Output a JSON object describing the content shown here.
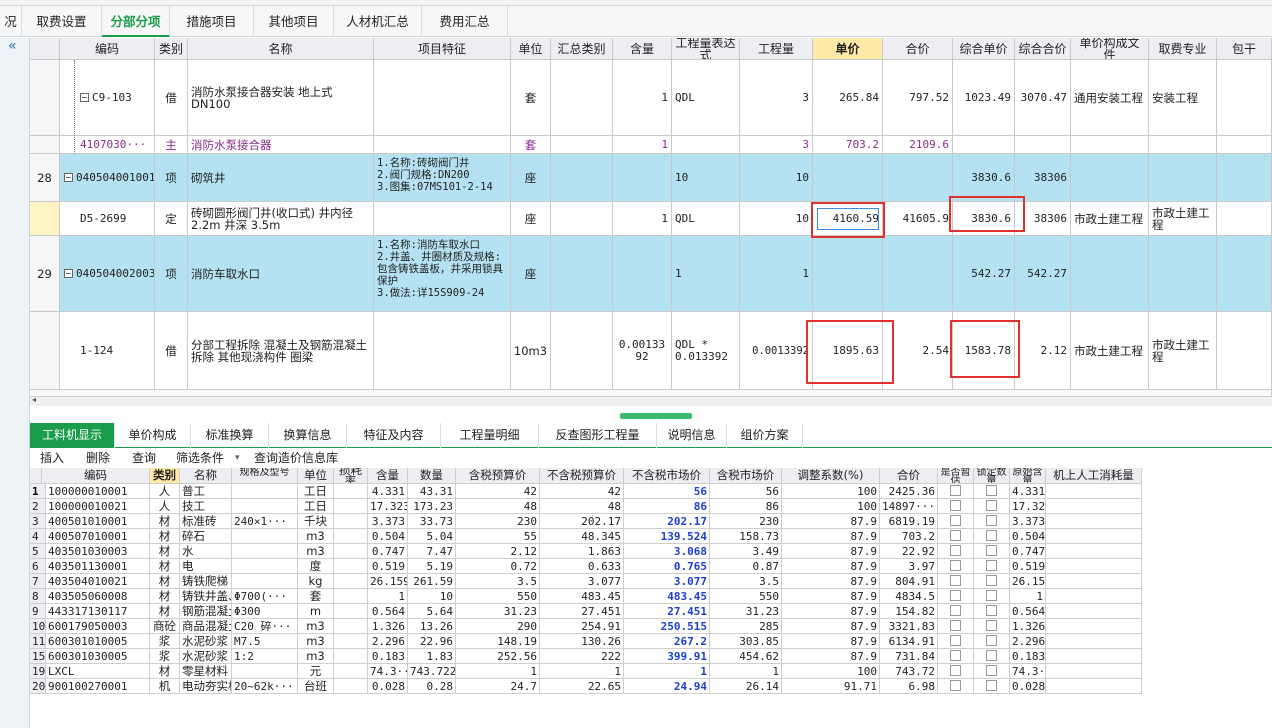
{
  "top_tabs": [
    "况",
    "取费设置",
    "分部分项",
    "措施项目",
    "其他项目",
    "人材机汇总",
    "费用汇总"
  ],
  "collapse_icon": "«",
  "grid": {
    "headers": [
      "编码",
      "类别",
      "名称",
      "项目特征",
      "单位",
      "汇总类别",
      "含量",
      "工程量表达式",
      "工程量",
      "单价",
      "合价",
      "综合单价",
      "综合合价",
      "单价构成文件",
      "取费专业",
      "包干"
    ],
    "rows": [
      {
        "no": "",
        "code": "C9-103",
        "type": "借",
        "name": "消防水泵接合器安装 地上式DN100",
        "feature": "",
        "unit": "套",
        "sum_cat": "",
        "content": "1",
        "expr": "QDL",
        "qty": "3",
        "price": "265.84",
        "total": "797.52",
        "comp_price": "1023.49",
        "comp_total": "3070.47",
        "file": "通用安装工程",
        "major": "安装工程"
      },
      {
        "no": "",
        "code": "4107030···",
        "type": "主",
        "name": "消防水泵接合器",
        "feature": "",
        "unit": "套",
        "sum_cat": "",
        "content": "1",
        "expr": "",
        "qty": "3",
        "price": "703.2",
        "total": "2109.6",
        "comp_price": "",
        "comp_total": "",
        "file": "",
        "major": ""
      },
      {
        "no": "28",
        "code": "040504001001",
        "type": "项",
        "name": "砌筑井",
        "feature": "1.名称:砖砌阀门井\n2.阀门规格:DN200\n3.图集:07MS101-2-14",
        "unit": "座",
        "sum_cat": "",
        "content": "",
        "expr": "10",
        "qty": "10",
        "price": "",
        "total": "",
        "comp_price": "3830.6",
        "comp_total": "38306",
        "file": "",
        "major": ""
      },
      {
        "no": "",
        "code": "D5-2699",
        "type": "定",
        "name": "砖砌圆形阀门井(收口式) 井内径2.2m 井深 3.5m",
        "feature": "",
        "unit": "座",
        "sum_cat": "",
        "content": "1",
        "expr": "QDL",
        "qty": "10",
        "price": "4160.59",
        "total": "41605.9",
        "comp_price": "3830.6",
        "comp_total": "38306",
        "file": "市政土建工程",
        "major": "市政土建工程"
      },
      {
        "no": "29",
        "code": "040504002003",
        "type": "项",
        "name": "消防车取水口",
        "feature": "1.名称:消防车取水口\n2.井盖、井圈材质及规格:包含铸铁盖板，井采用锁具保护\n3.做法:详15S909-24",
        "unit": "座",
        "sum_cat": "",
        "content": "",
        "expr": "1",
        "qty": "1",
        "price": "",
        "total": "",
        "comp_price": "542.27",
        "comp_total": "542.27",
        "file": "",
        "major": ""
      },
      {
        "no": "",
        "code": "1-124",
        "type": "借",
        "name": "分部工程拆除 混凝土及钢筋混凝土拆除 其他现浇构件 圈梁",
        "feature": "",
        "unit": "10m3",
        "sum_cat": "",
        "content": "0.0013392",
        "expr": "QDL * 0.013392",
        "qty": "0.0013392",
        "price": "1895.63",
        "total": "2.54",
        "comp_price": "1583.78",
        "comp_total": "2.12",
        "file": "市政土建工程",
        "major": "市政土建工程"
      }
    ]
  },
  "bottom_tabs": [
    "工料机显示",
    "单价构成",
    "标准换算",
    "换算信息",
    "特征及内容",
    "工程量明细",
    "反查图形工程量",
    "说明信息",
    "组价方案"
  ],
  "toolbar": [
    "插入",
    "删除",
    "查询",
    "筛选条件",
    "▾",
    "查询造价信息库"
  ],
  "lower": {
    "headers": [
      "编码",
      "类别",
      "名称",
      "规格及型号",
      "单位",
      "损耗率",
      "含量",
      "数量",
      "含税预算价",
      "不含税预算价",
      "不含税市场价",
      "含税市场价",
      "调整系数(%)",
      "合价",
      "是否暂估",
      "锁定数量",
      "原始含量",
      "机上人工消耗量"
    ],
    "rows": [
      {
        "no": "1",
        "code": "100000010001",
        "type": "人",
        "name": "普工",
        "spec": "",
        "unit": "工日",
        "loss": "",
        "content": "4.331",
        "qty": "43.31",
        "tax_budget": "42",
        "notax_budget": "42",
        "notax_market": "56",
        "tax_market": "56",
        "factor": "100",
        "total": "2425.36",
        "orig": "4.331"
      },
      {
        "no": "2",
        "code": "100000010021",
        "type": "人",
        "name": "技工",
        "spec": "",
        "unit": "工日",
        "loss": "",
        "content": "17.323",
        "qty": "173.23",
        "tax_budget": "48",
        "notax_budget": "48",
        "notax_market": "86",
        "tax_market": "86",
        "factor": "100",
        "total": "14897···",
        "orig": "17.323"
      },
      {
        "no": "3",
        "code": "400501010001",
        "type": "材",
        "name": "标准砖",
        "spec": "240×1···",
        "unit": "千块",
        "loss": "",
        "content": "3.373",
        "qty": "33.73",
        "tax_budget": "230",
        "notax_budget": "202.17",
        "notax_market": "202.17",
        "tax_market": "230",
        "factor": "87.9",
        "total": "6819.19",
        "orig": "3.373"
      },
      {
        "no": "4",
        "code": "400507010001",
        "type": "材",
        "name": "碎石",
        "spec": "",
        "unit": "m3",
        "loss": "",
        "content": "0.504",
        "qty": "5.04",
        "tax_budget": "55",
        "notax_budget": "48.345",
        "notax_market": "139.524",
        "tax_market": "158.73",
        "factor": "87.9",
        "total": "703.2",
        "orig": "0.504"
      },
      {
        "no": "5",
        "code": "403501030003",
        "type": "材",
        "name": "水",
        "spec": "",
        "unit": "m3",
        "loss": "",
        "content": "0.747",
        "qty": "7.47",
        "tax_budget": "2.12",
        "notax_budget": "1.863",
        "notax_market": "3.068",
        "tax_market": "3.49",
        "factor": "87.9",
        "total": "22.92",
        "orig": "0.747"
      },
      {
        "no": "6",
        "code": "403501130001",
        "type": "材",
        "name": "电",
        "spec": "",
        "unit": "度",
        "loss": "",
        "content": "0.519",
        "qty": "5.19",
        "tax_budget": "0.72",
        "notax_budget": "0.633",
        "notax_market": "0.765",
        "tax_market": "0.87",
        "factor": "87.9",
        "total": "3.97",
        "orig": "0.519"
      },
      {
        "no": "7",
        "code": "403504010021",
        "type": "材",
        "name": "铸铁爬梯",
        "spec": "",
        "unit": "kg",
        "loss": "",
        "content": "26.159",
        "qty": "261.59",
        "tax_budget": "3.5",
        "notax_budget": "3.077",
        "notax_market": "3.077",
        "tax_market": "3.5",
        "factor": "87.9",
        "total": "804.91",
        "orig": "26.159"
      },
      {
        "no": "8",
        "code": "403505060008",
        "type": "材",
        "name": "铸铁井盖、井座",
        "spec": "Φ700(···",
        "unit": "套",
        "loss": "",
        "content": "1",
        "qty": "10",
        "tax_budget": "550",
        "notax_budget": "483.45",
        "notax_market": "483.45",
        "tax_market": "550",
        "factor": "87.9",
        "total": "4834.5",
        "orig": "1"
      },
      {
        "no": "9",
        "code": "443317130117",
        "type": "材",
        "name": "钢筋混凝土管",
        "spec": "Φ300",
        "unit": "m",
        "loss": "",
        "content": "0.564",
        "qty": "5.64",
        "tax_budget": "31.23",
        "notax_budget": "27.451",
        "notax_market": "27.451",
        "tax_market": "31.23",
        "factor": "87.9",
        "total": "154.82",
        "orig": "0.564"
      },
      {
        "no": "10",
        "code": "600179050003",
        "type": "商砼",
        "name": "商品混凝土",
        "spec": "C20 碎···",
        "unit": "m3",
        "loss": "",
        "content": "1.326",
        "qty": "13.26",
        "tax_budget": "290",
        "notax_budget": "254.91",
        "notax_market": "250.515",
        "tax_market": "285",
        "factor": "87.9",
        "total": "3321.83",
        "orig": "1.326"
      },
      {
        "no": "11",
        "code": "600301010005",
        "type": "浆",
        "name": "水泥砂浆",
        "spec": "M7.5",
        "unit": "m3",
        "loss": "",
        "content": "2.296",
        "qty": "22.96",
        "tax_budget": "148.19",
        "notax_budget": "130.26",
        "notax_market": "267.2",
        "tax_market": "303.85",
        "factor": "87.9",
        "total": "6134.91",
        "orig": "2.296"
      },
      {
        "no": "15",
        "code": "600301030005",
        "type": "浆",
        "name": "水泥砂浆",
        "spec": "1:2",
        "unit": "m3",
        "loss": "",
        "content": "0.183",
        "qty": "1.83",
        "tax_budget": "252.56",
        "notax_budget": "222",
        "notax_market": "399.91",
        "tax_market": "454.62",
        "factor": "87.9",
        "total": "731.84",
        "orig": "0.183"
      },
      {
        "no": "19",
        "code": "LXCL",
        "type": "材",
        "name": "零星材料",
        "spec": "",
        "unit": "元",
        "loss": "",
        "content": "74.3···",
        "qty": "743.722",
        "tax_budget": "1",
        "notax_budget": "1",
        "notax_market": "1",
        "tax_market": "1",
        "factor": "100",
        "total": "743.72",
        "orig": "74.3···"
      },
      {
        "no": "20",
        "code": "900100270001",
        "type": "机",
        "name": "电动夯实机",
        "spec": "20~62k···",
        "unit": "台班",
        "loss": "",
        "content": "0.028",
        "qty": "0.28",
        "tax_budget": "24.7",
        "notax_budget": "22.65",
        "notax_market": "24.94",
        "tax_market": "26.14",
        "factor": "91.71",
        "total": "6.98",
        "orig": "0.028"
      }
    ]
  },
  "colors": {
    "accent": "#1a9d4a",
    "row_blue": "#b5e2f3",
    "highlight_red": "#e03131",
    "market_blue": "#1c3fd1"
  }
}
